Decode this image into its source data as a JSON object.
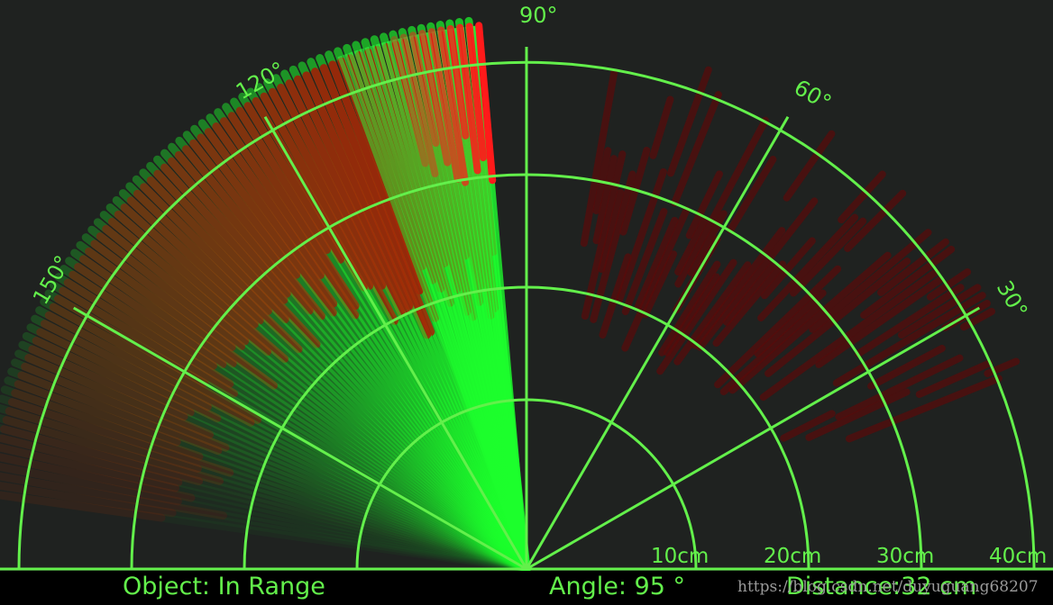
{
  "radar": {
    "background": "#1f2220",
    "grid_color": "#63f04b",
    "sweep_color": "#1cff2c",
    "detect_color": "#e00000",
    "angle_labels": [
      "30°",
      "60°",
      "90°",
      "120°",
      "150°"
    ],
    "range_labels": [
      "10cm",
      "20cm",
      "30cm",
      "40cm"
    ],
    "current_angle_deg": 95
  },
  "status": {
    "object": "Object: In Range",
    "angle": "Angle: 95 °",
    "distance": "Distance:32 cm"
  },
  "watermark": "https://blog.csdn.net/duyuguang68207"
}
